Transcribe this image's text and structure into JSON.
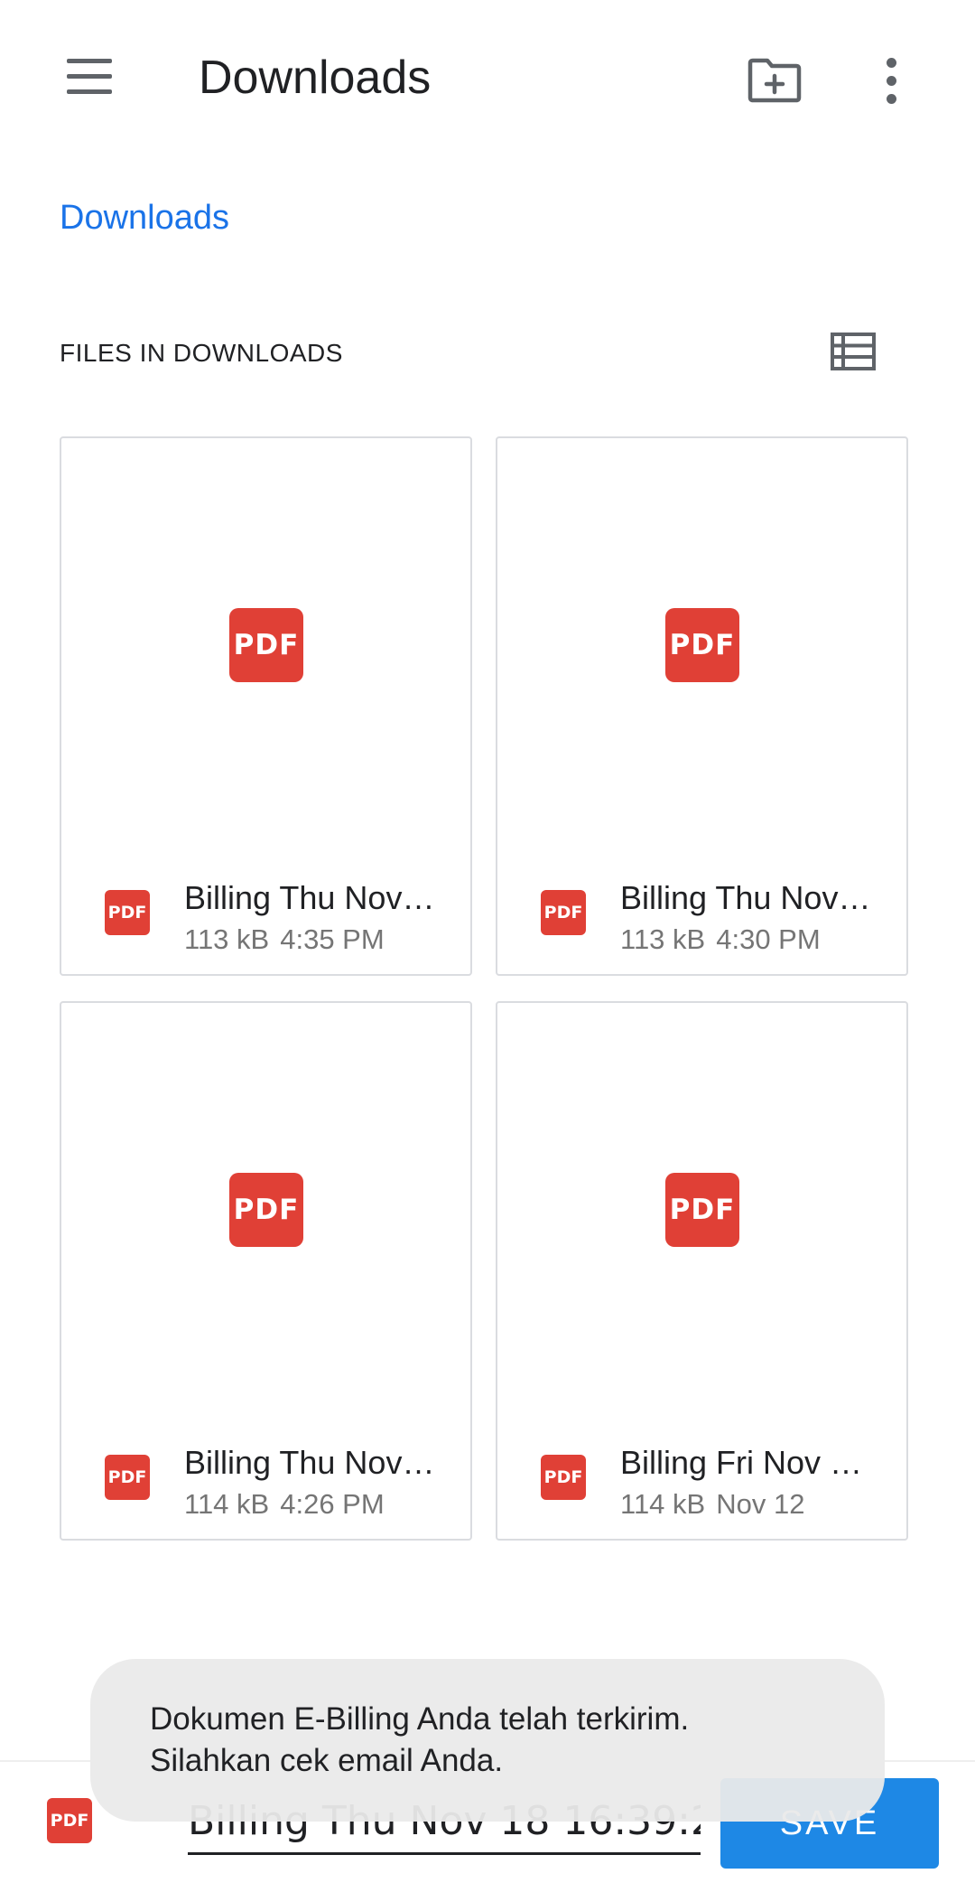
{
  "appbar": {
    "title": "Downloads",
    "icons": {
      "menu": "menu-icon",
      "new_folder": "create-new-folder-icon",
      "more": "more-vert-icon"
    }
  },
  "breadcrumb": {
    "label": "Downloads"
  },
  "section": {
    "title": "FILES IN DOWNLOADS",
    "view_icon": "list-view-icon"
  },
  "files": [
    {
      "name": "Billing Thu Nov…",
      "size": "113 kB",
      "time": "4:35 PM",
      "thumb": "PDF",
      "icon": "PDF"
    },
    {
      "name": "Billing Thu Nov…",
      "size": "113 kB",
      "time": "4:30 PM",
      "thumb": "PDF",
      "icon": "PDF"
    },
    {
      "name": "Billing Thu Nov…",
      "size": "114 kB",
      "time": "4:26 PM",
      "thumb": "PDF",
      "icon": "PDF"
    },
    {
      "name": "Billing Fri Nov …",
      "size": "114 kB",
      "time": "Nov 12",
      "thumb": "PDF",
      "icon": "PDF"
    }
  ],
  "savebar": {
    "icon": "PDF",
    "filename_value": "Billing Thu Nov 18 16:39:2",
    "save_label": "SAVE"
  },
  "toast": {
    "line1": "Dokumen E-Billing Anda telah terkirim.",
    "line2": "Silahkan cek email Anda."
  },
  "colors": {
    "accent": "#1a73e8",
    "pdf_red": "#e04036",
    "save_button": "#1e88e5"
  }
}
